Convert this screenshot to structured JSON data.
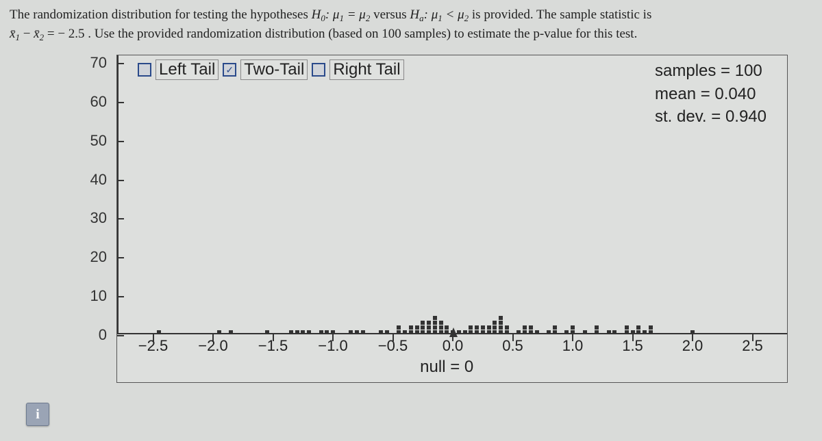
{
  "question": {
    "line1_a": "The randomization distribution for testing the hypotheses ",
    "h0": "H",
    "h0_sub": "0",
    "mu": "μ",
    "eq": " = ",
    "vs": " versus ",
    "ha": "H",
    "ha_sub": "a",
    "lt": " < ",
    "line1_b": " is provided. The sample statistic is",
    "line2_a": " = ",
    "stat": "− 2.5",
    "line2_b": ". Use the provided randomization distribution (based on 100 samples) to estimate the p-value for this test.",
    "x1": "x̄",
    "x1sub": "1",
    "x2": "x̄",
    "x2sub": "2",
    "minus": " − "
  },
  "controls": {
    "left_tail": "Left Tail",
    "two_tail": "Two-Tail",
    "right_tail": "Right Tail",
    "left_checked": false,
    "two_checked": true,
    "right_checked": false
  },
  "stats": {
    "samples_label": "samples = ",
    "samples": "100",
    "mean_label": "mean = ",
    "mean": "0.040",
    "sd_label": "st. dev. = ",
    "sd": "0.940"
  },
  "axes": {
    "y_ticks": [
      0,
      10,
      20,
      30,
      40,
      50,
      60,
      70
    ],
    "x_ticks": [
      -2.5,
      -2.0,
      -1.5,
      -1.0,
      -0.5,
      0.0,
      0.5,
      1.0,
      1.5,
      2.0,
      2.5
    ],
    "y_max": 70,
    "x_min": -2.8,
    "x_max": 2.8,
    "null_label": "null = 0",
    "zero_label": "0.0"
  },
  "chart_data": {
    "type": "dotplot",
    "title": "",
    "xlabel": "",
    "ylabel": "",
    "xlim": [
      -2.8,
      2.8
    ],
    "ylim": [
      0,
      70
    ],
    "null_value": 0,
    "samples": 100,
    "mean": 0.04,
    "st_dev": 0.94,
    "points": [
      {
        "x": -2.45,
        "count": 1
      },
      {
        "x": -1.95,
        "count": 1
      },
      {
        "x": -1.85,
        "count": 1
      },
      {
        "x": -1.55,
        "count": 1
      },
      {
        "x": -1.35,
        "count": 1
      },
      {
        "x": -1.3,
        "count": 1
      },
      {
        "x": -1.25,
        "count": 1
      },
      {
        "x": -1.2,
        "count": 1
      },
      {
        "x": -1.1,
        "count": 1
      },
      {
        "x": -1.05,
        "count": 1
      },
      {
        "x": -1.0,
        "count": 1
      },
      {
        "x": -0.85,
        "count": 1
      },
      {
        "x": -0.8,
        "count": 1
      },
      {
        "x": -0.75,
        "count": 1
      },
      {
        "x": -0.6,
        "count": 1
      },
      {
        "x": -0.55,
        "count": 1
      },
      {
        "x": -0.45,
        "count": 2
      },
      {
        "x": -0.4,
        "count": 1
      },
      {
        "x": -0.35,
        "count": 2
      },
      {
        "x": -0.3,
        "count": 2
      },
      {
        "x": -0.25,
        "count": 3
      },
      {
        "x": -0.2,
        "count": 3
      },
      {
        "x": -0.15,
        "count": 4
      },
      {
        "x": -0.1,
        "count": 3
      },
      {
        "x": -0.05,
        "count": 2
      },
      {
        "x": 0.0,
        "count": 1
      },
      {
        "x": 0.05,
        "count": 1
      },
      {
        "x": 0.1,
        "count": 1
      },
      {
        "x": 0.15,
        "count": 2
      },
      {
        "x": 0.2,
        "count": 2
      },
      {
        "x": 0.25,
        "count": 2
      },
      {
        "x": 0.3,
        "count": 2
      },
      {
        "x": 0.35,
        "count": 3
      },
      {
        "x": 0.4,
        "count": 4
      },
      {
        "x": 0.45,
        "count": 2
      },
      {
        "x": 0.55,
        "count": 1
      },
      {
        "x": 0.6,
        "count": 2
      },
      {
        "x": 0.65,
        "count": 2
      },
      {
        "x": 0.7,
        "count": 1
      },
      {
        "x": 0.8,
        "count": 1
      },
      {
        "x": 0.85,
        "count": 2
      },
      {
        "x": 0.95,
        "count": 1
      },
      {
        "x": 1.0,
        "count": 2
      },
      {
        "x": 1.1,
        "count": 1
      },
      {
        "x": 1.2,
        "count": 2
      },
      {
        "x": 1.3,
        "count": 1
      },
      {
        "x": 1.35,
        "count": 1
      },
      {
        "x": 1.45,
        "count": 2
      },
      {
        "x": 1.5,
        "count": 1
      },
      {
        "x": 1.55,
        "count": 2
      },
      {
        "x": 1.6,
        "count": 1
      },
      {
        "x": 1.65,
        "count": 2
      },
      {
        "x": 2.0,
        "count": 1
      }
    ]
  },
  "info_icon": "i"
}
